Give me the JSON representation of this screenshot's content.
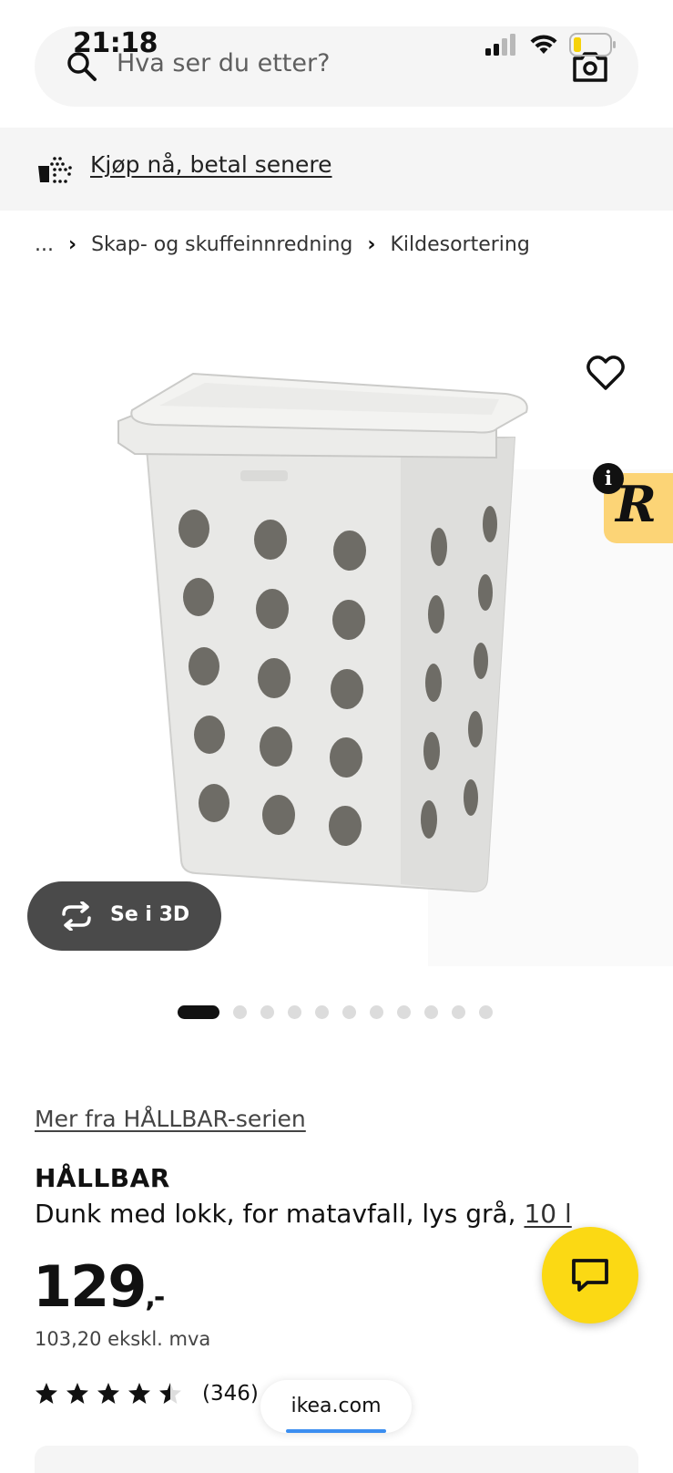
{
  "status_bar": {
    "time": "21:18"
  },
  "search": {
    "placeholder": "Hva ser du etter?"
  },
  "promo": {
    "label": "Kjøp nå, betal senere"
  },
  "breadcrumb": {
    "items": [
      "...",
      "Skap- og skuffeinnredning",
      "Kildesortering"
    ]
  },
  "gallery": {
    "view_3d_label": "Se i 3D",
    "dots_total": 11,
    "active_dot": 1,
    "review_widget_letter": "R",
    "info_badge": "i"
  },
  "product": {
    "series_link": "Mer fra HÅLLBAR-serien",
    "name": "HÅLLBAR",
    "description": "Dunk med lokk, for matavfall, lys grå, ",
    "size_link": "10 l",
    "price_main": "129",
    "price_suffix": ",-",
    "price_excl_vat": "103,20 ekskl. mva",
    "rating_value": 4.5,
    "rating_count": "(346)"
  },
  "browser": {
    "url": "ikea.com"
  },
  "colors": {
    "accent_yellow": "#fbd914",
    "review_widget": "#fcd476",
    "button_dark": "#4a4a4a"
  }
}
